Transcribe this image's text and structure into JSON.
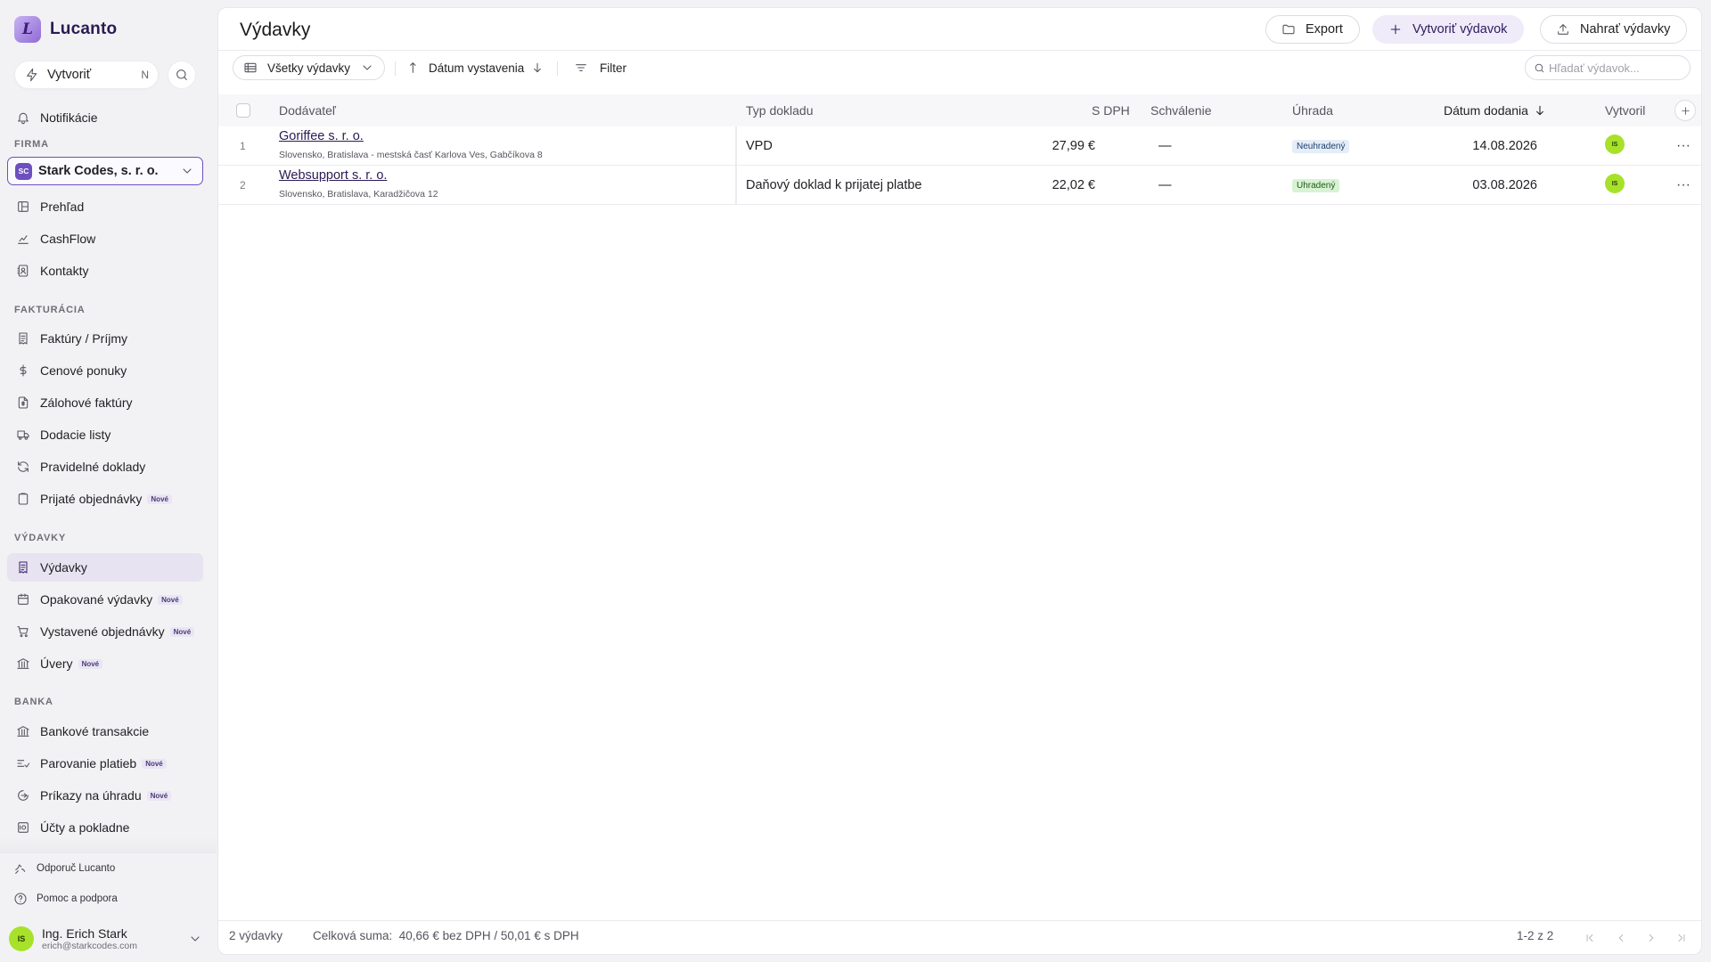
{
  "app": {
    "name": "Lucanto",
    "logo_letter": "L"
  },
  "sidebar": {
    "create": {
      "label": "Vytvoriť",
      "shortcut": "N"
    },
    "notifications": "Notifikácie",
    "company_section": "FIRMA",
    "company": {
      "initials": "SC",
      "name": "Stark Codes, s. r. o."
    },
    "general": [
      {
        "label": "Prehľad",
        "icon": "layout-icon"
      },
      {
        "label": "CashFlow",
        "icon": "chart-icon"
      },
      {
        "label": "Kontakty",
        "icon": "contacts-icon"
      }
    ],
    "billing_section": "FAKTURÁCIA",
    "billing": [
      {
        "label": "Faktúry / Príjmy",
        "icon": "receipt-icon",
        "new": ""
      },
      {
        "label": "Cenové ponuky",
        "icon": "dollar-icon",
        "new": ""
      },
      {
        "label": "Zálohové faktúry",
        "icon": "file-dollar-icon",
        "new": ""
      },
      {
        "label": "Dodacie listy",
        "icon": "truck-icon",
        "new": ""
      },
      {
        "label": "Pravidelné doklady",
        "icon": "refresh-icon",
        "new": ""
      },
      {
        "label": "Prijaté objednávky",
        "icon": "clipboard-icon",
        "new": "Nové"
      }
    ],
    "expenses_section": "VÝDAVKY",
    "expenses": [
      {
        "label": "Výdavky",
        "icon": "receipt-icon",
        "new": ""
      },
      {
        "label": "Opakované výdavky",
        "icon": "calendar-repeat-icon",
        "new": "Nové"
      },
      {
        "label": "Vystavené objednávky",
        "icon": "cart-icon",
        "new": "Nové"
      },
      {
        "label": "Úvery",
        "icon": "bank-icon",
        "new": "Nové"
      }
    ],
    "bank_section": "BANKA",
    "bank": [
      {
        "label": "Bankové transakcie",
        "icon": "bank-icon",
        "new": ""
      },
      {
        "label": "Parovanie platieb",
        "icon": "match-icon",
        "new": "Nové"
      },
      {
        "label": "Príkazy na úhradu",
        "icon": "transfer-icon",
        "new": "Nové"
      },
      {
        "label": "Účty a pokladne",
        "icon": "safe-icon",
        "new": ""
      }
    ],
    "footer": {
      "referral": "Odporuč Lucanto",
      "help": "Pomoc a podpora",
      "user_initials": "IS",
      "user_name": "Ing. Erich Stark",
      "user_email": "erich@starkcodes.com"
    }
  },
  "header": {
    "title": "Výdavky",
    "export": "Export",
    "create_expense": "Vytvoriť výdavok",
    "upload": "Nahrať výdavky"
  },
  "toolbar": {
    "view": "Všetky výdavky",
    "sort": "Dátum vystavenia",
    "filter": "Filter",
    "search_placeholder": "Hľadať výdavok..."
  },
  "table": {
    "columns": {
      "vendor": "Dodávateľ",
      "doc_type": "Typ dokladu",
      "with_vat": "S DPH",
      "approval": "Schválenie",
      "payment": "Úhrada",
      "delivery_date": "Dátum dodania",
      "created_by": "Vytvoril"
    },
    "rows": [
      {
        "num": "1",
        "vendor": "Goriffee s. r. o.",
        "address": "Slovensko, Bratislava - mestská časť Karlova Ves, Gabčíkova 8",
        "doc_type": "VPD",
        "amount": "27,99 €",
        "approval": "—",
        "payment": "Neuhradený",
        "date": "14.08.2026",
        "creator": "IS"
      },
      {
        "num": "2",
        "vendor": "Websupport s. r. o.",
        "address": "Slovensko, Bratislava, Karadžičova 12",
        "doc_type": "Daňový doklad k prijatej platbe",
        "amount": "22,02 €",
        "approval": "—",
        "payment": "Uhradený",
        "date": "03.08.2026",
        "creator": "IS"
      }
    ]
  },
  "footer": {
    "count": "2 výdavky",
    "total": "Celková suma:  40,66 € bez DPH / 50,01 € s DPH",
    "pagination": "1-2 z 2"
  },
  "colors": {
    "accent": "#6d4fc0",
    "brand_dark": "#2b1b55",
    "avatar": "#a8e12a"
  }
}
